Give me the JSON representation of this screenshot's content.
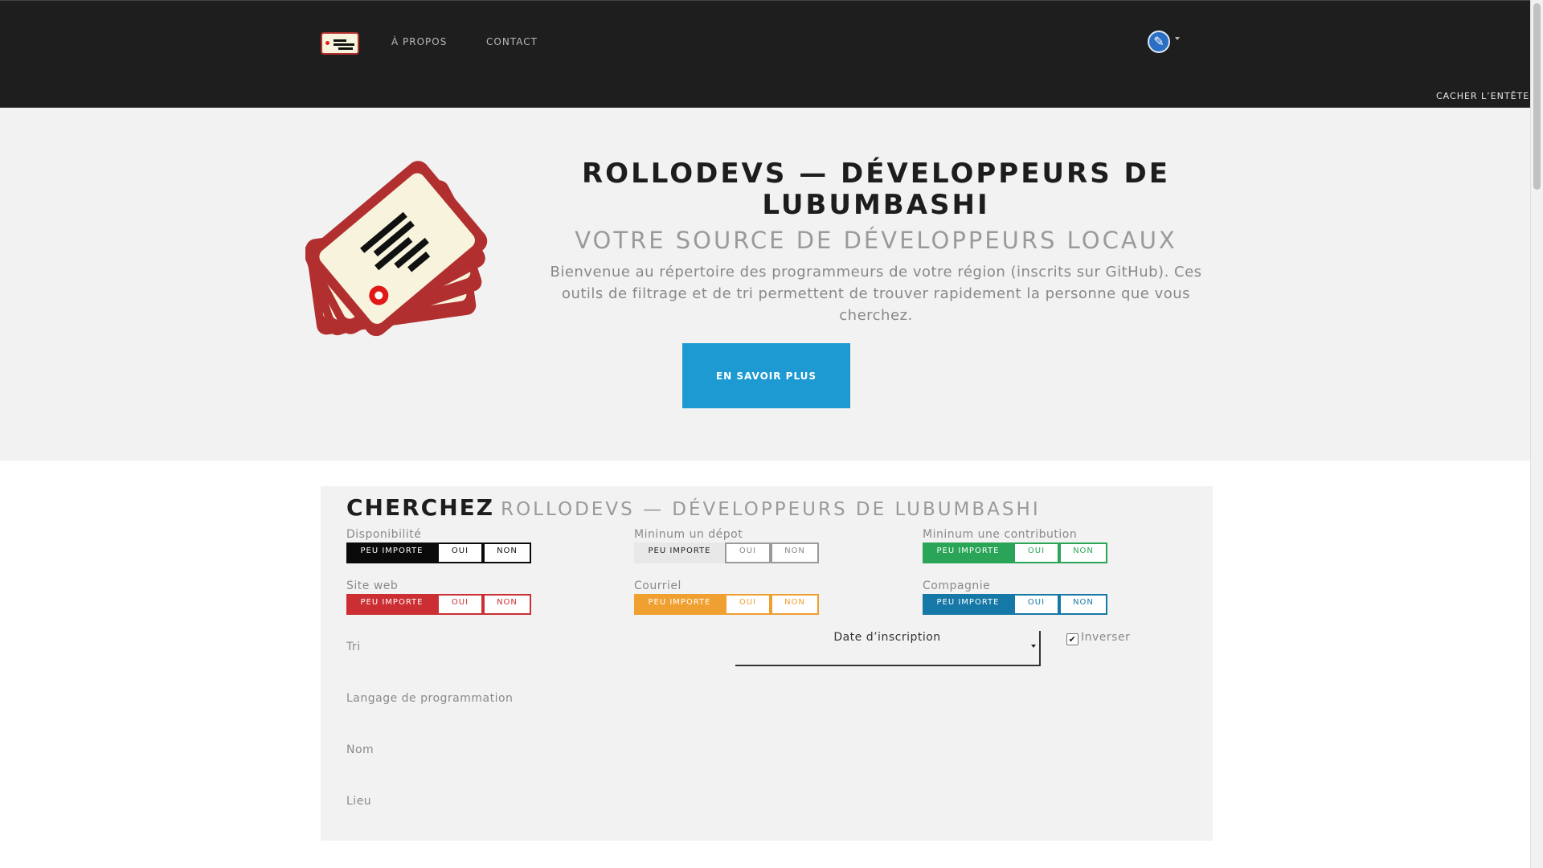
{
  "nav": {
    "links": [
      "À PROPOS",
      "CONTACT"
    ],
    "hide_header": "CACHER L’ENTÊTE"
  },
  "hero": {
    "title_line1": "ROLLODEVS — DÉVELOPPEURS DE",
    "title_line2": "LUBUMBASHI",
    "subtitle": "VOTRE SOURCE DE DÉVELOPPEURS LOCAUX",
    "description": "Bienvenue au répertoire des programmeurs de votre région (inscrits sur GitHub). Ces outils de filtrage et de tri permettent de trouver rapidement la personne que vous cherchez.",
    "button": "EN SAVOIR PLUS"
  },
  "search": {
    "title": "CHERCHEZ",
    "subtitle": "ROLLODEVS — DÉVELOPPEURS DE LUBUMBASHI",
    "options": [
      "PEU IMPORTE",
      "OUI",
      "NON"
    ],
    "filters": [
      {
        "label": "Disponibilité",
        "color": "#0a0a0a",
        "selected": "PEU IMPORTE"
      },
      {
        "label": "Mininum un dépot",
        "color": "#9a9a9a",
        "selected": "PEU IMPORTE"
      },
      {
        "label": "Mininum une contribution",
        "color": "#2aa558",
        "selected": "PEU IMPORTE"
      },
      {
        "label": "Site web",
        "color": "#cc2f33",
        "selected": "PEU IMPORTE"
      },
      {
        "label": "Courriel",
        "color": "#f0a030",
        "selected": "PEU IMPORTE"
      },
      {
        "label": "Compagnie",
        "color": "#1678a6",
        "selected": "PEU IMPORTE"
      }
    ],
    "sort_label": "Tri",
    "sort_value": "Date d’inscription",
    "invert_label": "Inverser",
    "invert_checked": true,
    "language_label": "Langage de programmation",
    "name_label": "Nom",
    "location_label": "Lieu"
  }
}
